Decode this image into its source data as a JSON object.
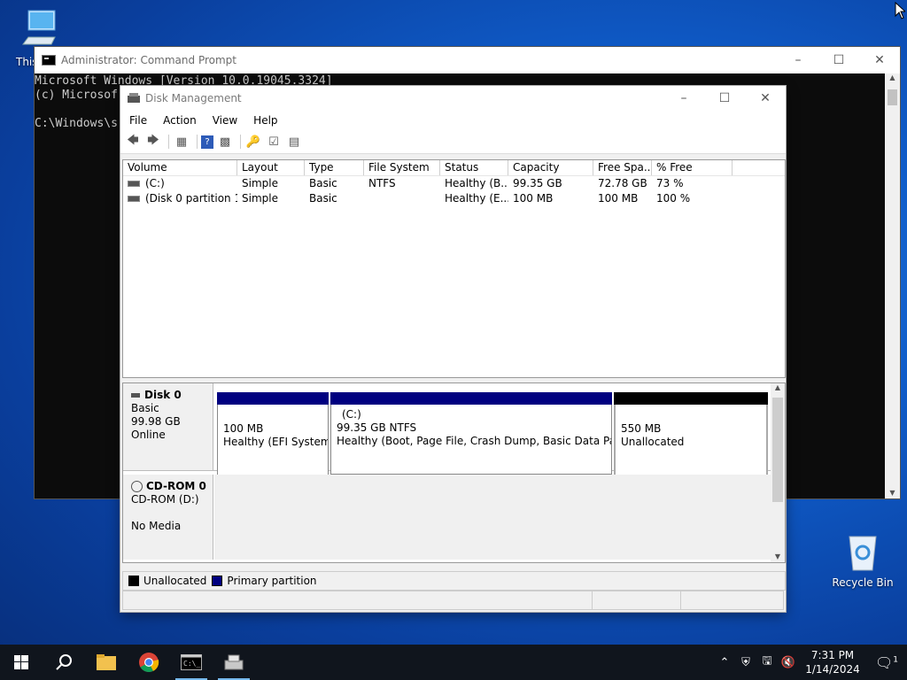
{
  "desktop": {
    "this_pc_label": "This",
    "recycle_bin_label": "Recycle Bin"
  },
  "cmd": {
    "title": "Administrator: Command Prompt",
    "lines": [
      "Microsoft Windows [Version 10.0.19045.3324]",
      "(c) Microsof",
      "",
      "C:\\Windows\\s"
    ]
  },
  "disk_management": {
    "title": "Disk Management",
    "menu": [
      "File",
      "Action",
      "View",
      "Help"
    ],
    "columns": [
      "Volume",
      "Layout",
      "Type",
      "File System",
      "Status",
      "Capacity",
      "Free Spa...",
      "% Free"
    ],
    "rows": [
      [
        "(C:)",
        "Simple",
        "Basic",
        "NTFS",
        "Healthy (B...",
        "99.35 GB",
        "72.78 GB",
        "73 %"
      ],
      [
        "(Disk 0 partition 1)",
        "Simple",
        "Basic",
        "",
        "Healthy (E...",
        "100 MB",
        "100 MB",
        "100 %"
      ]
    ],
    "disk0": {
      "name": "Disk 0",
      "type": "Basic",
      "size": "99.98 GB",
      "state": "Online",
      "partitions": [
        {
          "line1": "100 MB",
          "line2": "Healthy (EFI System P"
        },
        {
          "title": "(C:)",
          "line1": "99.35 GB NTFS",
          "line2": "Healthy (Boot, Page File, Crash Dump, Basic Data Partition"
        },
        {
          "line1": "550 MB",
          "line2": "Unallocated"
        }
      ]
    },
    "cdrom0": {
      "name": "CD-ROM 0",
      "drive": "CD-ROM (D:)",
      "media": "No Media"
    },
    "legend": {
      "unallocated": "Unallocated",
      "primary": "Primary partition",
      "unallocated_color": "#000000",
      "primary_color": "#000080"
    }
  },
  "taskbar": {
    "time": "7:31 PM",
    "date": "1/14/2024",
    "notification_count": "1"
  }
}
